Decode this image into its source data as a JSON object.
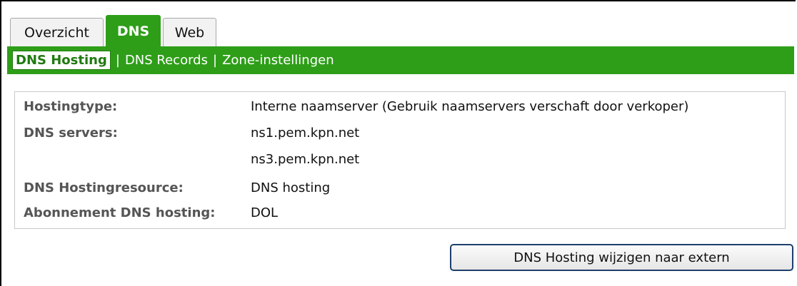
{
  "tabs": {
    "overzicht": "Overzicht",
    "dns": "DNS",
    "web": "Web",
    "active": "DNS"
  },
  "subnav": {
    "dns_hosting": "DNS Hosting",
    "dns_records": "DNS Records",
    "zone_instellingen": "Zone-instellingen",
    "separator": "|"
  },
  "details": {
    "hostingtype_label": "Hostingtype:",
    "hostingtype_value": "Interne naamserver (Gebruik naamservers verschaft door verkoper)",
    "dns_servers_label": "DNS servers:",
    "dns_server_1": "ns1.pem.kpn.net",
    "dns_server_2": "ns3.pem.kpn.net",
    "hostingresource_label": "DNS Hostingresource:",
    "hostingresource_value": "DNS hosting",
    "abonnement_label": "Abonnement DNS hosting:",
    "abonnement_value": "DOL"
  },
  "actions": {
    "change_button": "DNS Hosting wijzigen naar extern"
  },
  "colors": {
    "accent_green": "#2e9e18",
    "button_border": "#1e3f6b"
  }
}
